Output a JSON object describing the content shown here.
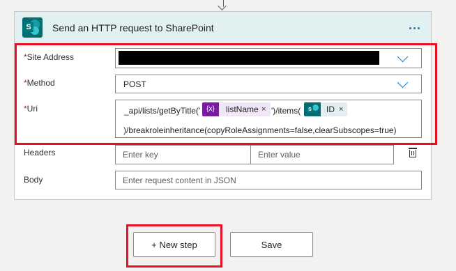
{
  "action": {
    "title": "Send an HTTP request to SharePoint",
    "more_label": "..."
  },
  "fields": {
    "site_address": {
      "label": "Site Address",
      "required_mark": "*",
      "value_redacted": true
    },
    "method": {
      "label": "Method",
      "required_mark": "*",
      "value": "POST"
    },
    "uri": {
      "label": "Uri",
      "required_mark": "*",
      "prefix": "_api/lists/getByTitle('",
      "token_list_name": {
        "icon": "{x}",
        "text": "listName",
        "remove": "×"
      },
      "middle": "')/items(",
      "token_id": {
        "icon": "sharepoint-icon",
        "text": "ID",
        "remove": "×"
      },
      "suffix": ")/breakroleinheritance(copyRoleAssignments=false,clearSubscopes=true)"
    },
    "headers": {
      "label": "Headers",
      "key_placeholder": "Enter key",
      "value_placeholder": "Enter value"
    },
    "body": {
      "label": "Body",
      "placeholder": "Enter request content in JSON"
    }
  },
  "buttons": {
    "new_step": "+ New step",
    "save": "Save"
  },
  "colors": {
    "header_bg": "#e1f1f1",
    "accent": "#0078d4",
    "highlight": "#e81123",
    "variable_token": "#771ba4",
    "sharepoint_token": "#036c70"
  }
}
